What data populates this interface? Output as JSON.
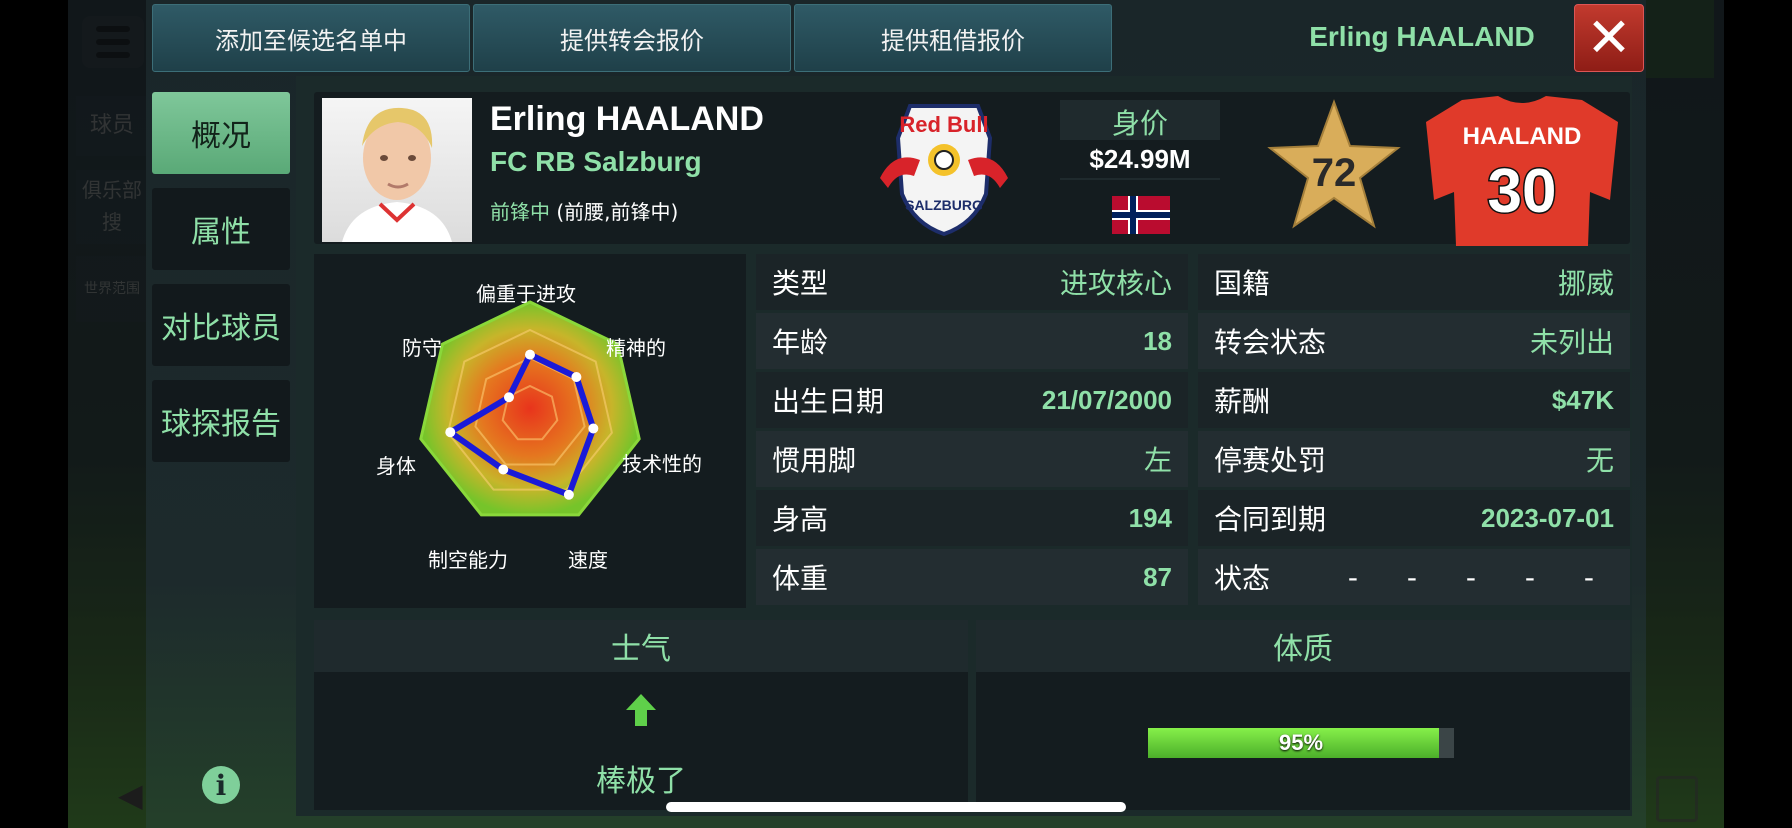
{
  "top_bar": {
    "add_shortlist": "添加至候选名单中",
    "transfer_offer": "提供转会报价",
    "loan_offer": "提供租借报价",
    "player_name": "Erling HAALAND"
  },
  "background": {
    "side_items": [
      "球员",
      "俱乐部搜",
      "世界范围"
    ]
  },
  "side_tabs": [
    "概况",
    "属性",
    "对比球员",
    "球探报告"
  ],
  "player": {
    "name": "Erling HAALAND",
    "club": "FC RB Salzburg",
    "position_main": "前锋中",
    "position_other": "(前腰,前锋中)",
    "value_label": "身价",
    "value": "$24.99M",
    "rating": "72",
    "shirt_name": "HAALAND",
    "shirt_number": "30",
    "club_logo_text": "Red Bull",
    "club_logo_sub": "SALZBURG"
  },
  "radar": {
    "labels": [
      "偏重于进攻",
      "精神的",
      "技术性的",
      "速度",
      "制空能力",
      "身体",
      "防守"
    ],
    "values": [
      0.53,
      0.53,
      0.58,
      0.8,
      0.55,
      0.73,
      0.24
    ]
  },
  "info_left": [
    {
      "key": "类型",
      "value": "进攻核心"
    },
    {
      "key": "年龄",
      "value": "18"
    },
    {
      "key": "出生日期",
      "value": "21/07/2000"
    },
    {
      "key": "惯用脚",
      "value": "左"
    },
    {
      "key": "身高",
      "value": "194"
    },
    {
      "key": "体重",
      "value": "87"
    }
  ],
  "info_right": [
    {
      "key": "国籍",
      "value": "挪威"
    },
    {
      "key": "转会状态",
      "value": "未列出"
    },
    {
      "key": "薪酬",
      "value": "$47K"
    },
    {
      "key": "停赛处罚",
      "value": "无"
    },
    {
      "key": "合同到期",
      "value": "2023-07-01"
    },
    {
      "key": "状态",
      "value": "- - - - -"
    }
  ],
  "morale": {
    "title": "士气",
    "status": "棒极了"
  },
  "fitness": {
    "title": "体质",
    "percent_text": "95%",
    "level": 0.95
  },
  "colors": {
    "accent": "#8fe0a8",
    "radar_line": "#1a1ad8",
    "close": "#b3261e",
    "shirt": "#e03a2a"
  }
}
